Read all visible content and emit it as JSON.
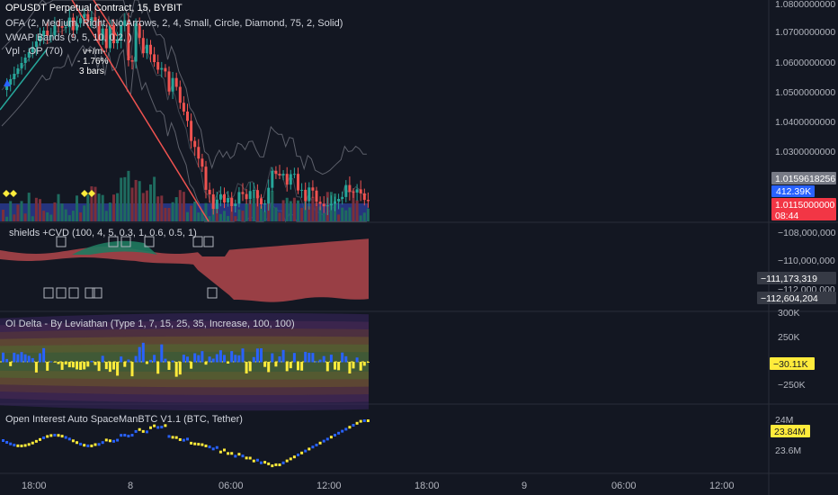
{
  "main": {
    "legend": [
      "OPUSDT Perpetual Contract, 15, BYBIT",
      "OFA (2, Medium, Right, No Arrows, 2, 4, Small, Circle, Diamond, 75, 2, Solid)",
      "VWAP Bands (9, 5, 10, 0.2, )",
      "Vpl · OP (70)"
    ],
    "price_axis": [
      "1.0800000000",
      "1.0700000000",
      "1.0600000000",
      "1.0500000000",
      "1.0400000000",
      "1.0300000000"
    ],
    "price_badges": {
      "top": "1.0159618256",
      "volume": "412.39K",
      "last": "1.0115000000",
      "countdown": "08:44"
    },
    "annotation": [
      "v+/m-",
      "- 1.76%",
      "3 bars"
    ]
  },
  "shields": {
    "legend": "shields +CVD (100, 4, 5, 0.3, 1, 0.6, 0.5, 1)",
    "axis": [
      "−108,000,000",
      "−110,000,000",
      "−112,000,000"
    ],
    "badges": [
      "−111,173,319",
      "−112,604,204"
    ]
  },
  "oidelta": {
    "legend": "OI Delta - By Leviathan (Type 1, 7, 15, 25, 35, Increase, 100, 100)",
    "axis_top_partial": "300K",
    "axis": [
      "250K",
      "−250K"
    ],
    "badge": "−30.11K"
  },
  "oi": {
    "legend": "Open Interest Auto SpaceManBTC V1.1 (BTC, Tether)",
    "axis": [
      "24M",
      "23.6M"
    ],
    "badge": "23.84M"
  },
  "time_axis": [
    "18:00",
    "8",
    "06:00",
    "12:00",
    "18:00",
    "9",
    "06:00",
    "12:00"
  ],
  "colors": {
    "background": "#131722",
    "up": "#26a69a",
    "down": "#ef5350",
    "volume_up": "#3b5bdb",
    "oi_blue": "#2962ff",
    "oi_yellow": "#ffeb3b",
    "cvd_red": "#b2474b",
    "badge_gray": "#787b86",
    "badge_blue": "#2962ff",
    "badge_red": "#f23645"
  }
}
